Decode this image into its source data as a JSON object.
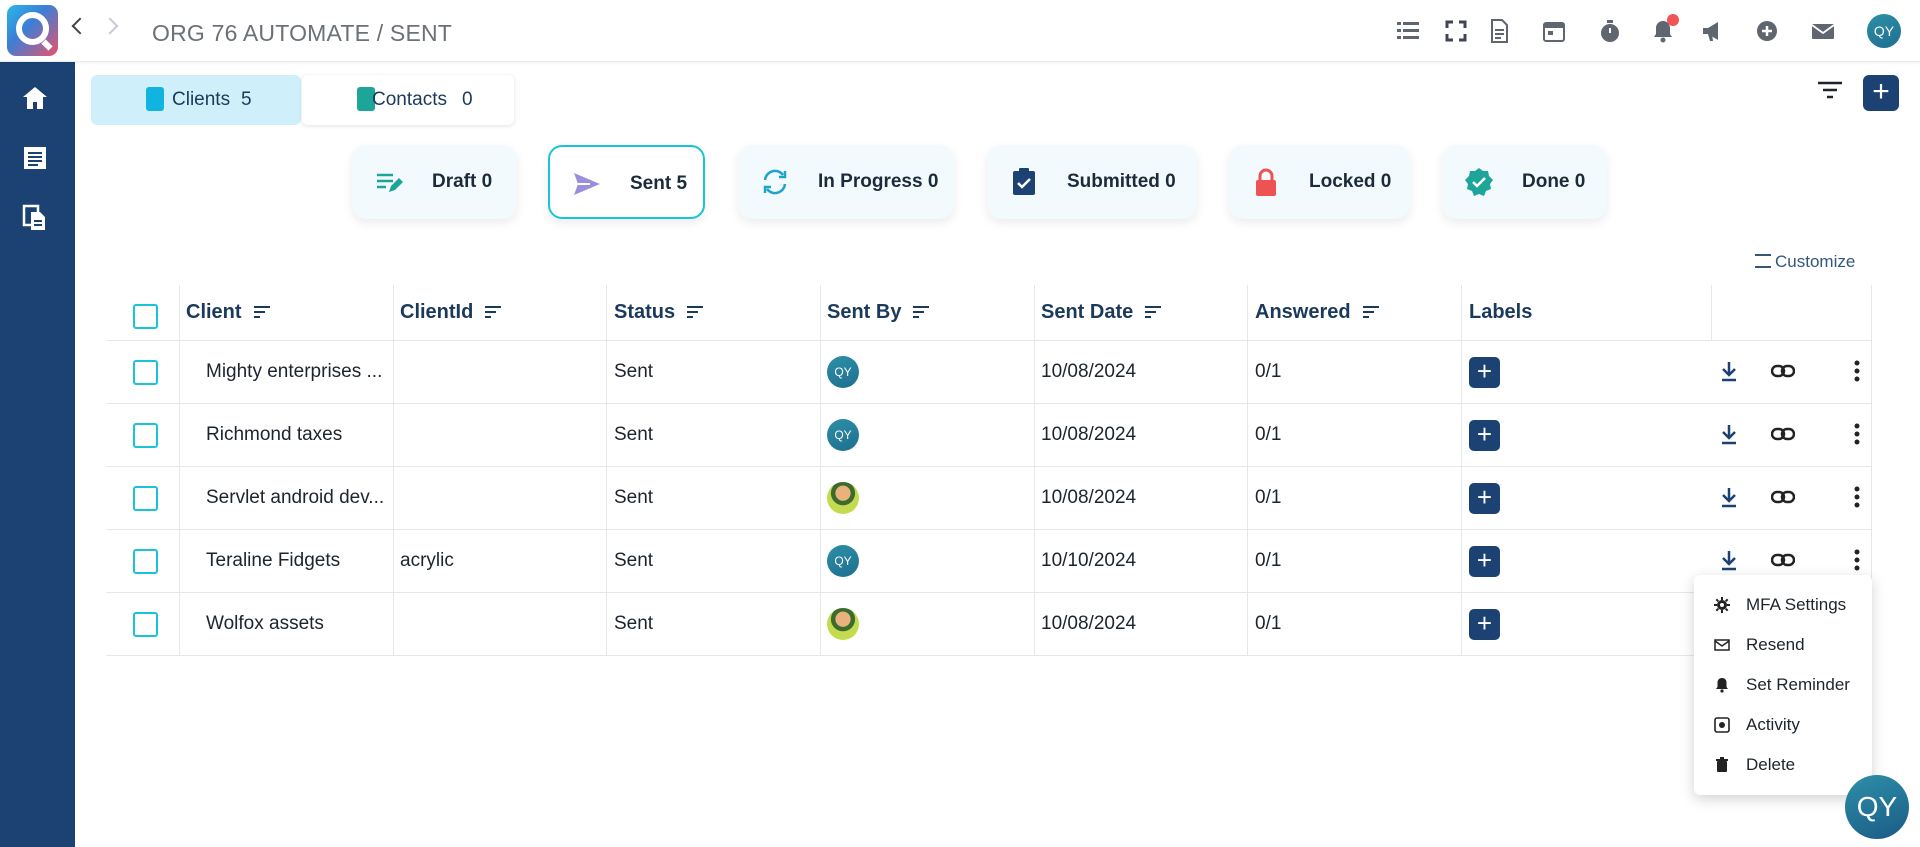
{
  "header": {
    "breadcrumb": "ORG 76 AUTOMATE / SENT",
    "avatar_initials": "QY",
    "icons": [
      "list-icon",
      "fullscreen-icon",
      "document-icon",
      "calendar-icon",
      "timer-icon",
      "bell-icon",
      "megaphone-icon",
      "plus-circle-icon",
      "mail-icon"
    ]
  },
  "sidebar": {
    "items": [
      {
        "icon": "home-icon"
      },
      {
        "icon": "list-document-icon"
      },
      {
        "icon": "copy-document-icon"
      }
    ]
  },
  "tabs": [
    {
      "label": "Clients",
      "count": "5",
      "active": true
    },
    {
      "label": "Contacts",
      "count": "0",
      "active": false
    }
  ],
  "status_cards": [
    {
      "label": "Draft 0",
      "icon": "edit-list-icon",
      "color": "#1da59a"
    },
    {
      "label": "Sent 5",
      "icon": "send-icon",
      "color": "#9b8fdd",
      "active": true
    },
    {
      "label": "In Progress 0",
      "icon": "sync-icon",
      "color": "#1fa4c8"
    },
    {
      "label": "Submitted 0",
      "icon": "clipboard-check-icon",
      "color": "#1b4273"
    },
    {
      "label": "Locked 0",
      "icon": "lock-icon",
      "color": "#ee5353"
    },
    {
      "label": "Done 0",
      "icon": "verified-badge-icon",
      "color": "#1da59a"
    }
  ],
  "customize_label": "Customize",
  "table": {
    "columns": [
      "Client",
      "ClientId",
      "Status",
      "Sent By",
      "Sent Date",
      "Answered",
      "Labels"
    ],
    "rows": [
      {
        "client": "Mighty enterprises ...",
        "client_id": "",
        "status": "Sent",
        "sent_by": "QY",
        "sent_by_type": "initials",
        "sent_date": "10/08/2024",
        "answered": "0/1"
      },
      {
        "client": "Richmond taxes",
        "client_id": "",
        "status": "Sent",
        "sent_by": "QY",
        "sent_by_type": "initials",
        "sent_date": "10/08/2024",
        "answered": "0/1"
      },
      {
        "client": "Servlet android dev...",
        "client_id": "",
        "status": "Sent",
        "sent_by": "",
        "sent_by_type": "photo",
        "sent_date": "10/08/2024",
        "answered": "0/1"
      },
      {
        "client": "Teraline Fidgets",
        "client_id": "acrylic",
        "status": "Sent",
        "sent_by": "QY",
        "sent_by_type": "initials",
        "sent_date": "10/10/2024",
        "answered": "0/1"
      },
      {
        "client": "Wolfox assets",
        "client_id": "",
        "status": "Sent",
        "sent_by": "",
        "sent_by_type": "photo",
        "sent_date": "10/08/2024",
        "answered": "0/1"
      }
    ]
  },
  "context_menu": {
    "items": [
      {
        "label": "MFA Settings",
        "icon": "gear-icon"
      },
      {
        "label": "Resend",
        "icon": "mail-resend-icon"
      },
      {
        "label": "Set Reminder",
        "icon": "bell-icon"
      },
      {
        "label": "Activity",
        "icon": "activity-icon"
      },
      {
        "label": "Delete",
        "icon": "trash-icon"
      }
    ]
  },
  "floating_avatar": "QY"
}
